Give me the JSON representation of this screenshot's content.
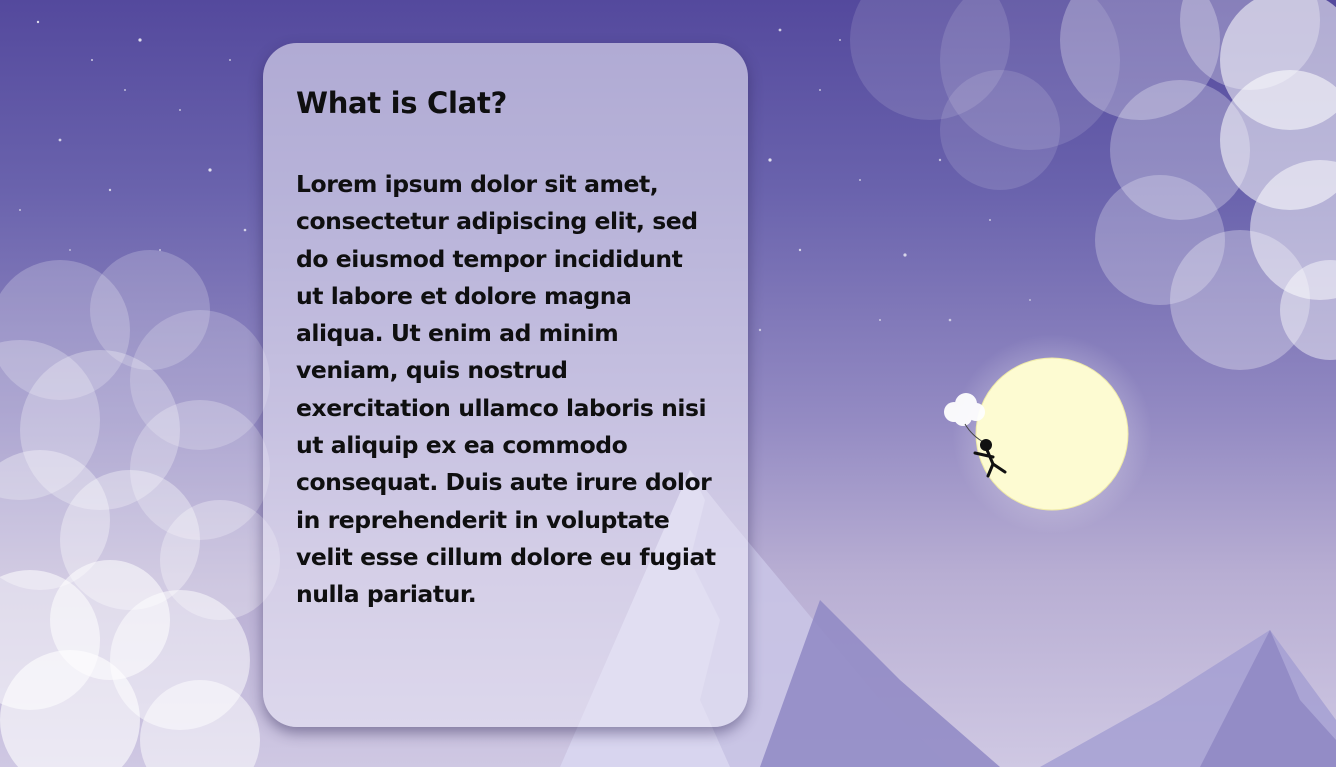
{
  "card": {
    "title": "What is Clat?",
    "body": "Lorem ipsum dolor sit amet, consectetur adipiscing elit, sed do eiusmod tempor incididunt ut labore et dolore magna aliqua. Ut enim ad minim veniam, quis nostrud exercitation ullamco laboris nisi ut aliquip ex ea commodo consequat. Duis aute irure dolor in reprehenderit in voluptate velit esse cillum dolore eu fugiat nulla pariatur."
  },
  "scene": {
    "moon_color": "#fdfbd2",
    "sky_top_color": "#54499d",
    "sky_bottom_color": "#cfc8e3",
    "cloud_color": "#ffffff",
    "mountain_color": "#9e97cc"
  }
}
